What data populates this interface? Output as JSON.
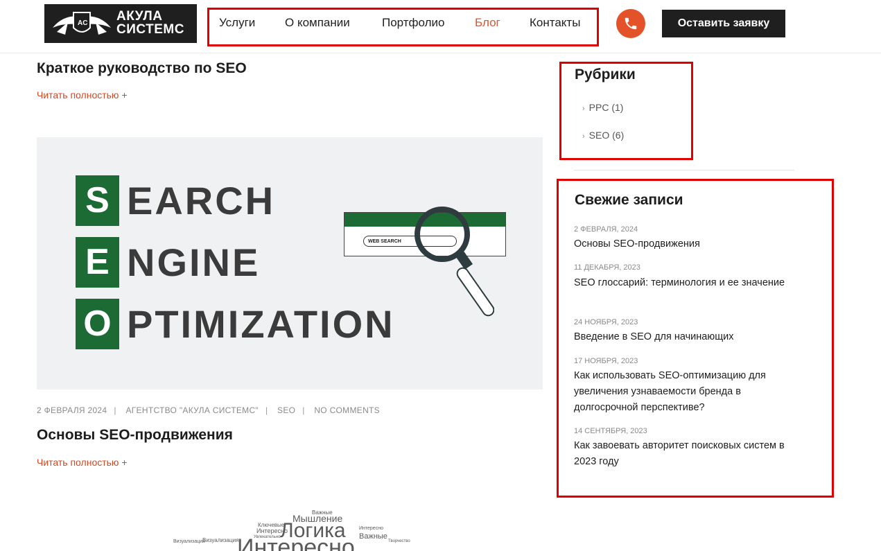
{
  "header": {
    "logo_text_line1": "АКУЛА",
    "logo_text_line2": "СИСТЕМС",
    "nav": [
      "Услуги",
      "О компании",
      "Портфолио",
      "Блог",
      "Контакты"
    ],
    "active_nav": "Блог",
    "phone_icon": "phone-icon",
    "cta_label": "Оставить заявку"
  },
  "posts": [
    {
      "title": "Краткое руководство по SEO",
      "read_more": "Читать полностью +"
    },
    {
      "image": {
        "letters": [
          "S",
          "E",
          "O"
        ],
        "words": [
          "EARCH",
          "NGINE",
          "PTIMIZATION"
        ],
        "search_text": "WEB SEARCH"
      },
      "meta": [
        "2 ФЕВРАЛЯ 2024",
        "АГЕНТСТВО \"АКУЛА СИСТЕМС\"",
        "SEO",
        "NO COMMENTS"
      ],
      "title": "Основы SEO-продвижения",
      "read_more": "Читать полностью +"
    }
  ],
  "word_cloud": [
    "Важные",
    "Мышление",
    "Ключевые",
    "Интересно",
    "Логика",
    "Интересно",
    "Важные",
    "Визуализация",
    "Визуализация",
    "Увлекательно",
    "Творчество",
    "Интересно"
  ],
  "sidebar": {
    "categories_title": "Рубрики",
    "categories": [
      "PPC (1)",
      "SEO (6)"
    ],
    "recent_title": "Свежие записи",
    "recent": [
      {
        "date": "2 ФЕВРАЛЯ, 2024",
        "title": "Основы SEO-продвижения"
      },
      {
        "date": "11 ДЕКАБРЯ, 2023",
        "title": "SEO глоссарий: терминология и ее значение"
      },
      {
        "date": "24 НОЯБРЯ, 2023",
        "title": "Введение в SEO для начинающих"
      },
      {
        "date": "17 НОЯБРЯ, 2023",
        "title": "Как использовать SEO-оптимизацию для увеличения узнаваемости бренда в долгосрочной перспективе?"
      },
      {
        "date": "14 СЕНТЯБРЯ, 2023",
        "title": "Как завоевать авторитет поисковых систем в 2023 году"
      }
    ]
  },
  "colors": {
    "accent": "#e4522a",
    "brand_green": "#1d6b34",
    "highlight_border": "#e10000",
    "dark": "#1f1f1f"
  }
}
